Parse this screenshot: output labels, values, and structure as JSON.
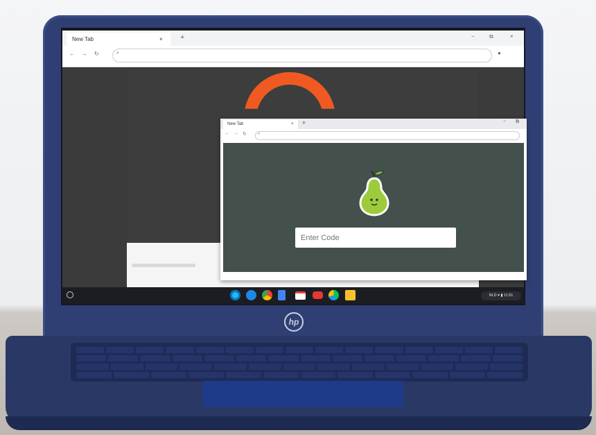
{
  "back_browser": {
    "tab_title": "New Tab",
    "tab_close": "×",
    "new_tab": "+",
    "window_controls": [
      "−",
      "⧉",
      "×"
    ]
  },
  "front_browser": {
    "tab_title": "New Tab",
    "tab_close": "×",
    "new_tab": "+",
    "window_controls": [
      "−",
      "⧉"
    ],
    "code_input": {
      "placeholder": "Enter Code",
      "value": ""
    },
    "logo": "pear-icon"
  },
  "shelf": {
    "launcher": "launcher-icon",
    "apps": [
      "chrome-icon",
      "files-icon",
      "docs-icon",
      "gmail-icon",
      "youtube-icon",
      "play-store-icon",
      "keep-icon"
    ],
    "status": "NLD ▾ ▮ 11:51"
  },
  "device": {
    "brand": "hp"
  },
  "colors": {
    "accent": "#f05a22",
    "pear_green": "#8bc34a",
    "content_bg": "#43504c"
  }
}
